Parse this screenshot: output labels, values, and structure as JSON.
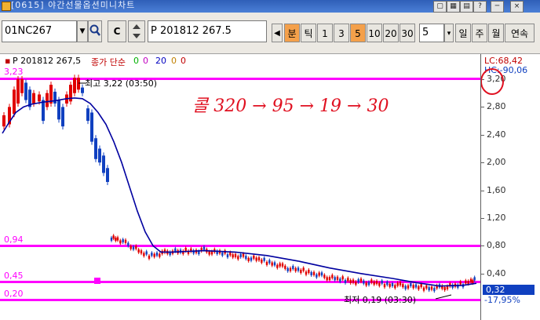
{
  "window": {
    "title": "[0615] 야간선물옵션미니차트"
  },
  "window_buttons": [
    "▢",
    "▦",
    "▤",
    "?",
    "─",
    "×"
  ],
  "toolbar": {
    "code": "01NC267",
    "code_dropdown": "▼",
    "c_label": "C",
    "instrument": "P 201812 267.5",
    "prev_arrow": "◀",
    "periods": [
      {
        "label": "분",
        "active": true
      },
      {
        "label": "틱",
        "active": false
      },
      {
        "label": "1",
        "active": false
      },
      {
        "label": "3",
        "active": false
      },
      {
        "label": "5",
        "active": true
      },
      {
        "label": "10",
        "active": false
      },
      {
        "label": "20",
        "active": false
      },
      {
        "label": "30",
        "active": false
      }
    ],
    "count": "5",
    "count_dropdown": "▾",
    "views": [
      "일",
      "주",
      "월",
      "연속"
    ]
  },
  "chart_header": {
    "instrument": "P 201812 267,5",
    "indicator": "종가 단순",
    "ma": [
      "0",
      "0",
      "20",
      "0",
      "0"
    ],
    "ma_colors": [
      "#00b000",
      "#c000c0",
      "#0000c0",
      "#c08000",
      "#c00000"
    ]
  },
  "axis": {
    "ticks": [
      "3,20",
      "2,80",
      "2,40",
      "2,00",
      "1,60",
      "1,20",
      "0,80",
      "0,40"
    ],
    "lc_label": "LC:68,42",
    "hc_label": "HC:-90,06",
    "current_value": "0,32",
    "change_pct": "-17,95%"
  },
  "levels": [
    {
      "label": "3,23",
      "value": 3.23
    },
    {
      "label": "0,94",
      "value": 0.94
    },
    {
      "label": "0,45",
      "value": 0.45
    },
    {
      "label": "0,20",
      "value": 0.2
    }
  ],
  "annotations": {
    "high": "최고 3,22 (03:50)",
    "low": "최저 0,19 (03:30)",
    "handwriting": "콜 320 → 95 → 19 → 30"
  },
  "colors": {
    "level": "#ff00ff",
    "up": "#e00000",
    "down": "#1040c0",
    "ma": "#0000a0",
    "handwriting": "#e01020",
    "period_active": "#f4a04a"
  },
  "chart_data": {
    "type": "line",
    "ylim": [
      0.0,
      3.5
    ],
    "ma_series": [
      [
        3,
        2.42
      ],
      [
        10,
        2.55
      ],
      [
        20,
        2.72
      ],
      [
        30,
        2.8
      ],
      [
        40,
        2.84
      ],
      [
        55,
        2.87
      ],
      [
        70,
        2.89
      ],
      [
        85,
        2.92
      ],
      [
        95,
        2.93
      ],
      [
        105,
        2.92
      ],
      [
        115,
        2.85
      ],
      [
        125,
        2.72
      ],
      [
        135,
        2.55
      ],
      [
        145,
        2.3
      ],
      [
        155,
        2.0
      ],
      [
        165,
        1.65
      ],
      [
        175,
        1.3
      ],
      [
        185,
        1.0
      ],
      [
        195,
        0.8
      ],
      [
        205,
        0.71
      ],
      [
        220,
        0.71
      ],
      [
        240,
        0.72
      ],
      [
        260,
        0.73
      ],
      [
        300,
        0.71
      ],
      [
        340,
        0.66
      ],
      [
        380,
        0.58
      ],
      [
        420,
        0.48
      ],
      [
        460,
        0.4
      ],
      [
        500,
        0.33
      ],
      [
        530,
        0.27
      ],
      [
        560,
        0.22
      ],
      [
        590,
        0.23
      ],
      [
        607,
        0.26
      ]
    ],
    "early_candles": [
      [
        5,
        2.52,
        2.68
      ],
      [
        12,
        2.55,
        2.8
      ],
      [
        18,
        2.7,
        3.05
      ],
      [
        23,
        2.85,
        3.2
      ],
      [
        28,
        3.0,
        3.2
      ],
      [
        33,
        2.9,
        3.15
      ],
      [
        38,
        2.8,
        3.05
      ],
      [
        43,
        2.85,
        3.0
      ],
      [
        50,
        2.88,
        2.98
      ],
      [
        55,
        2.6,
        2.9
      ],
      [
        60,
        2.8,
        3.0
      ],
      [
        65,
        2.85,
        3.12
      ],
      [
        70,
        2.85,
        3.02
      ],
      [
        75,
        2.62,
        2.9
      ],
      [
        80,
        2.52,
        2.8
      ],
      [
        85,
        2.85,
        2.98
      ],
      [
        90,
        2.88,
        3.12
      ],
      [
        95,
        3.0,
        3.22
      ],
      [
        100,
        3.05,
        3.22
      ],
      [
        105,
        3.0,
        3.08
      ],
      [
        112,
        2.6,
        2.78
      ],
      [
        117,
        2.3,
        2.72
      ],
      [
        122,
        2.05,
        2.35
      ],
      [
        127,
        2.0,
        2.2
      ],
      [
        132,
        1.85,
        2.1
      ],
      [
        137,
        1.72,
        1.92
      ]
    ],
    "late_path": [
      [
        142,
        0.92
      ],
      [
        150,
        0.9
      ],
      [
        160,
        0.84
      ],
      [
        170,
        0.78
      ],
      [
        180,
        0.7
      ],
      [
        190,
        0.66
      ],
      [
        200,
        0.68
      ],
      [
        210,
        0.7
      ],
      [
        220,
        0.72
      ],
      [
        230,
        0.71
      ],
      [
        240,
        0.73
      ],
      [
        250,
        0.72
      ],
      [
        260,
        0.74
      ],
      [
        270,
        0.71
      ],
      [
        280,
        0.7
      ],
      [
        290,
        0.68
      ],
      [
        300,
        0.66
      ],
      [
        310,
        0.64
      ],
      [
        320,
        0.62
      ],
      [
        330,
        0.6
      ],
      [
        340,
        0.57
      ],
      [
        350,
        0.54
      ],
      [
        360,
        0.5
      ],
      [
        370,
        0.47
      ],
      [
        380,
        0.45
      ],
      [
        390,
        0.43
      ],
      [
        400,
        0.4
      ],
      [
        410,
        0.37
      ],
      [
        420,
        0.34
      ],
      [
        430,
        0.32
      ],
      [
        440,
        0.31
      ],
      [
        450,
        0.29
      ],
      [
        460,
        0.28
      ],
      [
        470,
        0.27
      ],
      [
        480,
        0.26
      ],
      [
        490,
        0.25
      ],
      [
        500,
        0.24
      ],
      [
        510,
        0.23
      ],
      [
        520,
        0.22
      ],
      [
        530,
        0.21
      ],
      [
        540,
        0.2
      ],
      [
        550,
        0.19
      ],
      [
        560,
        0.2
      ],
      [
        570,
        0.21
      ],
      [
        580,
        0.22
      ],
      [
        590,
        0.25
      ],
      [
        600,
        0.3
      ],
      [
        607,
        0.32
      ]
    ]
  }
}
